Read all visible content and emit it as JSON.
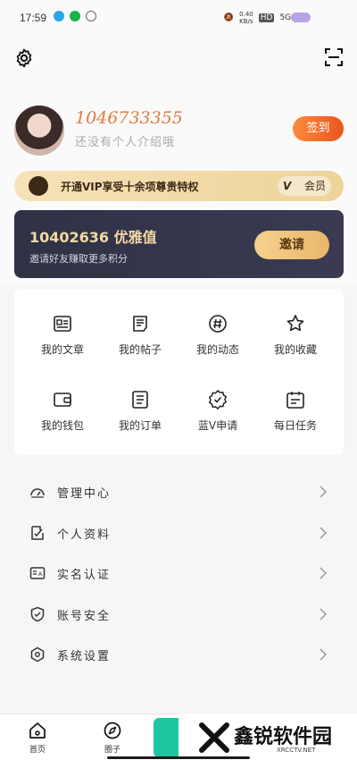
{
  "status_bar": {
    "time": "17:59",
    "badge": "HD",
    "network": "5G",
    "kbs": "0.40\nKB/s"
  },
  "profile": {
    "user_id": "1046733355",
    "bio_placeholder": "还没有个人介绍哦",
    "signin_label": "签到"
  },
  "vip": {
    "promo_text": "开通VIP享受十余项尊贵特权",
    "badge_text": "会员",
    "badge_prefix": "V"
  },
  "points": {
    "value_text": "10402636 优雅值",
    "hint": "邀请好友赚取更多积分",
    "invite_label": "邀请"
  },
  "grid_items": [
    {
      "label": "我的文章",
      "icon": "article-icon"
    },
    {
      "label": "我的帖子",
      "icon": "post-icon"
    },
    {
      "label": "我的动态",
      "icon": "hashtag-icon"
    },
    {
      "label": "我的收藏",
      "icon": "star-icon"
    },
    {
      "label": "我的钱包",
      "icon": "wallet-icon"
    },
    {
      "label": "我的订单",
      "icon": "order-icon"
    },
    {
      "label": "蓝V申请",
      "icon": "verified-badge-icon"
    },
    {
      "label": "每日任务",
      "icon": "calendar-icon"
    }
  ],
  "menu": [
    {
      "label": "管理中心",
      "icon": "dashboard-icon"
    },
    {
      "label": "个人资料",
      "icon": "edit-profile-icon"
    },
    {
      "label": "实名认证",
      "icon": "id-card-icon"
    },
    {
      "label": "账号安全",
      "icon": "shield-icon"
    },
    {
      "label": "系统设置",
      "icon": "settings-icon"
    }
  ],
  "bottom_nav": [
    {
      "label": "首页",
      "icon": "home-icon"
    },
    {
      "label": "圈子",
      "icon": "compass-icon"
    }
  ],
  "watermark": {
    "title": "鑫锐软件园",
    "url": "XRCCTV.NET"
  }
}
